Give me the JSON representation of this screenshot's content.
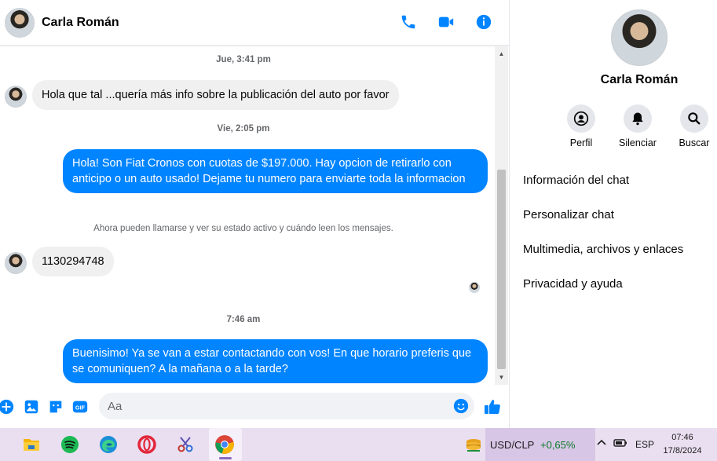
{
  "colors": {
    "accent": "#0084ff",
    "incoming_bubble": "#f0f0f0",
    "taskbar": "#eadff0",
    "stock_up": "#0b7a2b"
  },
  "header": {
    "name": "Carla Román",
    "icons": [
      "phone-icon",
      "video-camera-icon",
      "info-icon"
    ]
  },
  "messages": {
    "ts1": "Jue, 3:41 pm",
    "in1": "Hola que tal ...quería más info sobre la publicación del auto por favor",
    "ts2": "Vie, 2:05 pm",
    "out1": "Hola! Son Fiat Cronos con cuotas de $197.000. Hay opcion de retirarlo con anticipo o un auto usado! Dejame tu numero para enviarte toda la informacion",
    "system": "Ahora pueden llamarse y ver su estado activo y cuándo leen los mensajes.",
    "in2": "1130294748",
    "ts3": "7:46 am",
    "out2": "Buenisimo! Ya se van a estar contactando con vos! En que horario preferis que se comuniquen? A la mañana o a la tarde?"
  },
  "composer": {
    "placeholder": "Aa",
    "icons": [
      "plus-circle-icon",
      "image-icon",
      "sticker-icon",
      "gif-icon",
      "emoji-icon",
      "thumbs-up-icon"
    ],
    "gif_label": "GIF"
  },
  "panel": {
    "name": "Carla Román",
    "actions": [
      {
        "label": "Perfil",
        "icon": "profile-icon"
      },
      {
        "label": "Silenciar",
        "icon": "bell-icon"
      },
      {
        "label": "Buscar",
        "icon": "search-icon"
      }
    ],
    "items": [
      "Información del chat",
      "Personalizar chat",
      "Multimedia, archivos y enlaces",
      "Privacidad y ayuda"
    ]
  },
  "taskbar": {
    "apps": [
      "file-explorer-icon",
      "spotify-icon",
      "edge-icon",
      "opera-icon",
      "snipping-tool-icon",
      "chrome-icon"
    ],
    "stock": {
      "name": "USD/CLP",
      "change": "+0,65%"
    },
    "language": "ESP",
    "time": "07:46",
    "date": "17/8/2024"
  }
}
